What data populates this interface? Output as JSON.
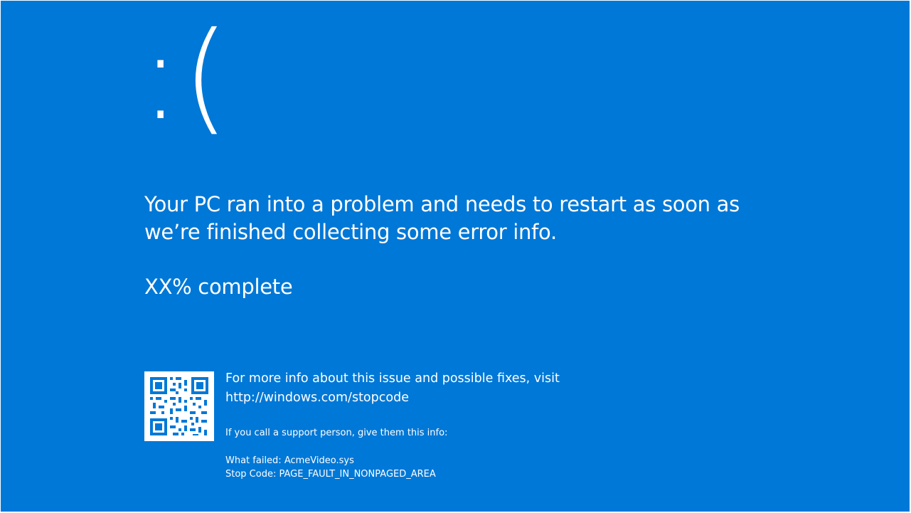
{
  "screen": {
    "background_color": "#0078d7",
    "text_color": "#ffffff",
    "sad_face": ":(",
    "message": "Your PC ran into a problem and needs to restart as soon as we’re finished collecting some error info.",
    "progress": "XX% complete",
    "qr_code_icon": "qr-code-icon",
    "more_info_line": "For more info about this issue and possible fixes, visit",
    "stopcode_link": "http://windows.com/stopcode",
    "support_line": "If you call a support person, give them this info:",
    "what_failed": "What failed: AcmeVideo.sys",
    "stop_code": "Stop Code: PAGE_FAULT_IN_NONPAGED_AREA"
  }
}
